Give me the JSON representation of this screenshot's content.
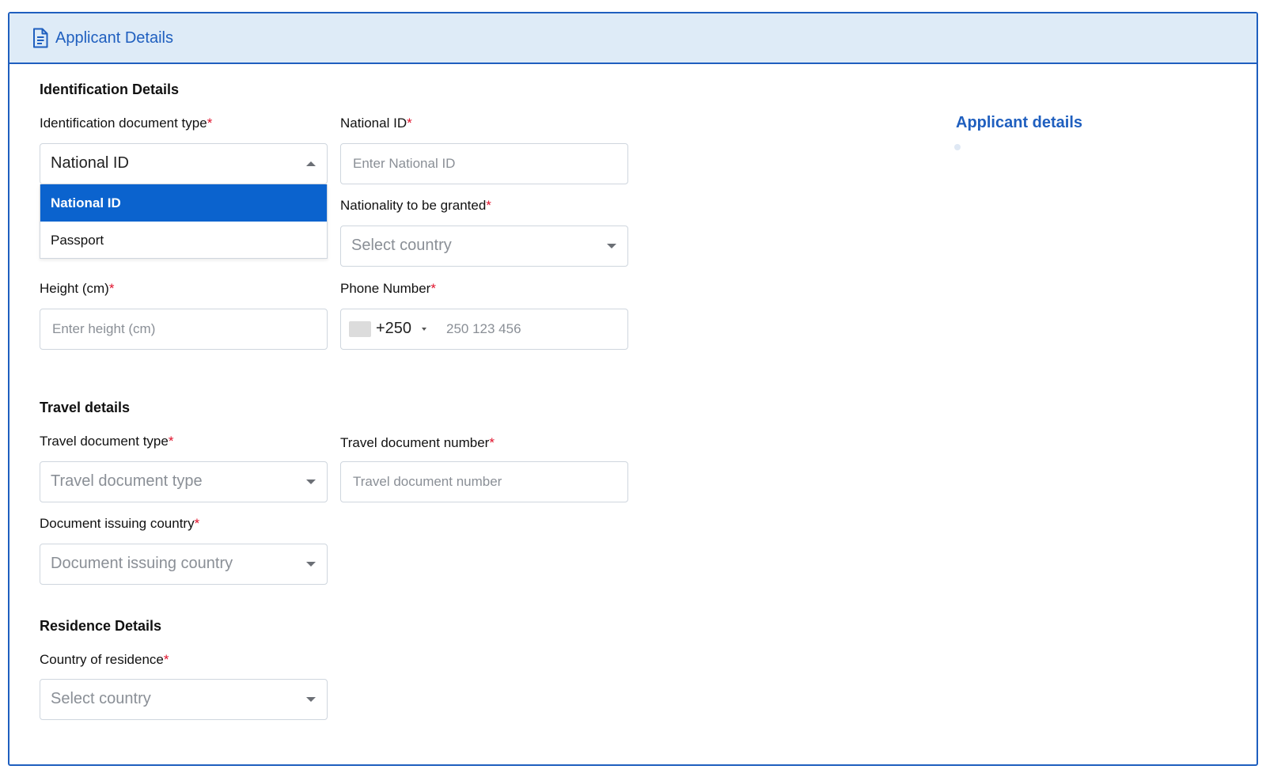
{
  "header": {
    "title": "Applicant Details"
  },
  "sections": {
    "identification": {
      "title": "Identification Details",
      "doc_type": {
        "label": "Identification document type",
        "value": "National ID",
        "options": [
          "National ID",
          "Passport"
        ],
        "selected_index": 0
      },
      "national_id": {
        "label": "National ID",
        "placeholder": "Enter National ID"
      },
      "nationality": {
        "label": "Nationality to be granted",
        "placeholder": "Select country"
      },
      "height": {
        "label": "Height (cm)",
        "placeholder": "Enter height (cm)"
      },
      "phone": {
        "label": "Phone Number",
        "country_code": "+250",
        "placeholder": "250 123 456"
      }
    },
    "travel": {
      "title": "Travel details",
      "doc_type": {
        "label": "Travel document type",
        "placeholder": "Travel document type"
      },
      "doc_number": {
        "label": "Travel document number",
        "placeholder": "Travel document number"
      },
      "issuing_country": {
        "label": "Document issuing country",
        "placeholder": "Document issuing country"
      }
    },
    "residence": {
      "title": "Residence Details",
      "country": {
        "label": "Country of residence",
        "placeholder": "Select country"
      }
    }
  },
  "sidebar": {
    "nav_title": "Applicant details"
  },
  "required_marker": "*",
  "colors": {
    "accent": "#1f5fbf",
    "header_bg": "#deebf7",
    "selected_option_bg": "#0b63ce",
    "required": "#e0112b"
  }
}
